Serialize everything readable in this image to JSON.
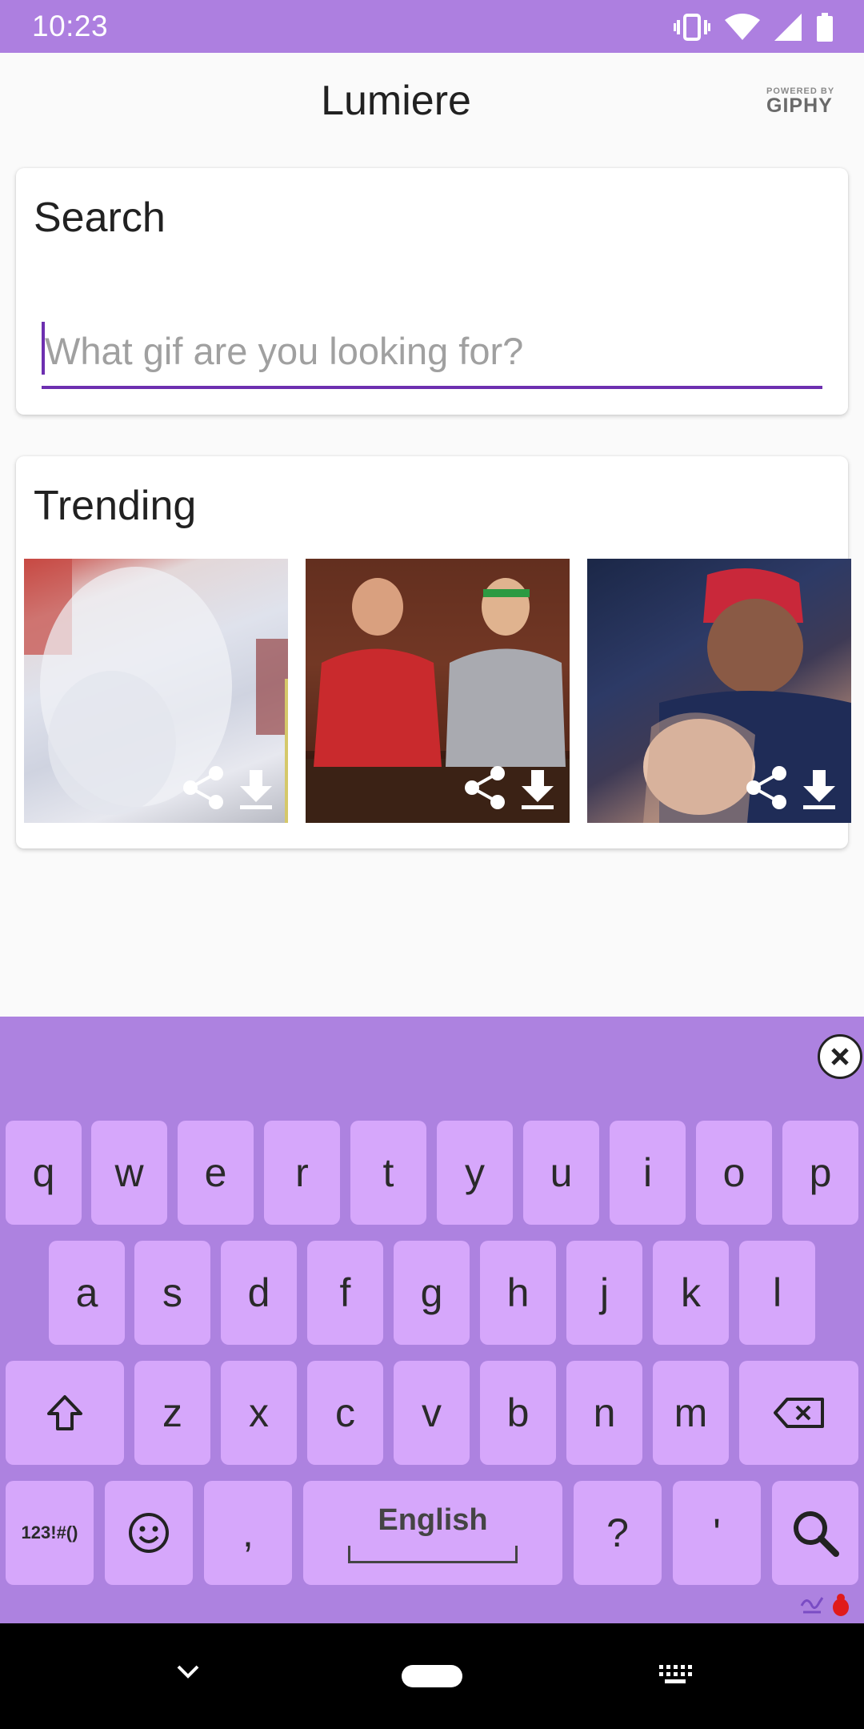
{
  "status_bar": {
    "time": "10:23"
  },
  "app_bar": {
    "title": "Lumiere",
    "giphy_small": "POWERED BY",
    "giphy_big": "GIPHY"
  },
  "search": {
    "title": "Search",
    "placeholder": "What gif are you looking for?",
    "value": ""
  },
  "trending": {
    "title": "Trending",
    "gifs": [
      {
        "share_icon": "share-icon",
        "download_icon": "download-icon"
      },
      {
        "share_icon": "share-icon",
        "download_icon": "download-icon"
      },
      {
        "share_icon": "share-icon",
        "download_icon": "download-icon"
      }
    ]
  },
  "keyboard": {
    "row1": [
      "q",
      "w",
      "e",
      "r",
      "t",
      "y",
      "u",
      "i",
      "o",
      "p"
    ],
    "row2": [
      "a",
      "s",
      "d",
      "f",
      "g",
      "h",
      "j",
      "k",
      "l"
    ],
    "row3": [
      "z",
      "x",
      "c",
      "v",
      "b",
      "n",
      "m"
    ],
    "symbols_key": "123!#()",
    "comma_key": ",",
    "space_label": "English",
    "question_key": "?",
    "apostrophe_key": "'",
    "accent_color": "#ad82e0",
    "key_color": "#d6a7fb"
  },
  "colors": {
    "status_bar": "#ad7fe0",
    "accent": "#6d2fb0",
    "background": "#fafafa"
  }
}
